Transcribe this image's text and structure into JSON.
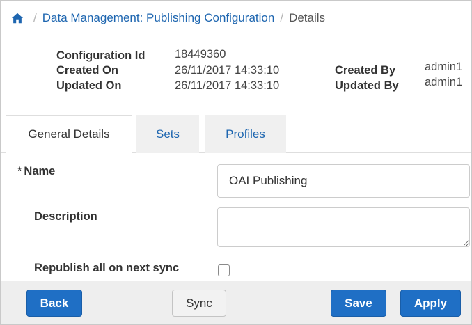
{
  "breadcrumb": {
    "home_icon": "home-icon",
    "separator": "/",
    "parent": "Data Management: Publishing Configuration",
    "current": "Details"
  },
  "info": {
    "config_id_label": "Configuration Id",
    "config_id_value": "18449360",
    "created_on_label": "Created On",
    "created_on_value": "26/11/2017 14:33:10",
    "updated_on_label": "Updated On",
    "updated_on_value": "26/11/2017 14:33:10",
    "created_by_label": "Created By",
    "created_by_value": "admin1",
    "updated_by_label": "Updated By",
    "updated_by_value": "admin1"
  },
  "tabs": [
    {
      "label": "General Details",
      "active": true
    },
    {
      "label": "Sets",
      "active": false
    },
    {
      "label": "Profiles",
      "active": false
    }
  ],
  "form": {
    "name_required_mark": "*",
    "name_label": "Name",
    "name_value": "OAI Publishing",
    "description_label": "Description",
    "description_value": "",
    "republish_label": "Republish all on next sync",
    "republish_checked": false
  },
  "footer": {
    "back_label": "Back",
    "sync_label": "Sync",
    "save_label": "Save",
    "apply_label": "Apply"
  },
  "colors": {
    "link": "#1e66b0",
    "primary_button": "#1f6fc5",
    "footer_bg": "#eeeeee",
    "inactive_tab_bg": "#f0f0f0"
  }
}
